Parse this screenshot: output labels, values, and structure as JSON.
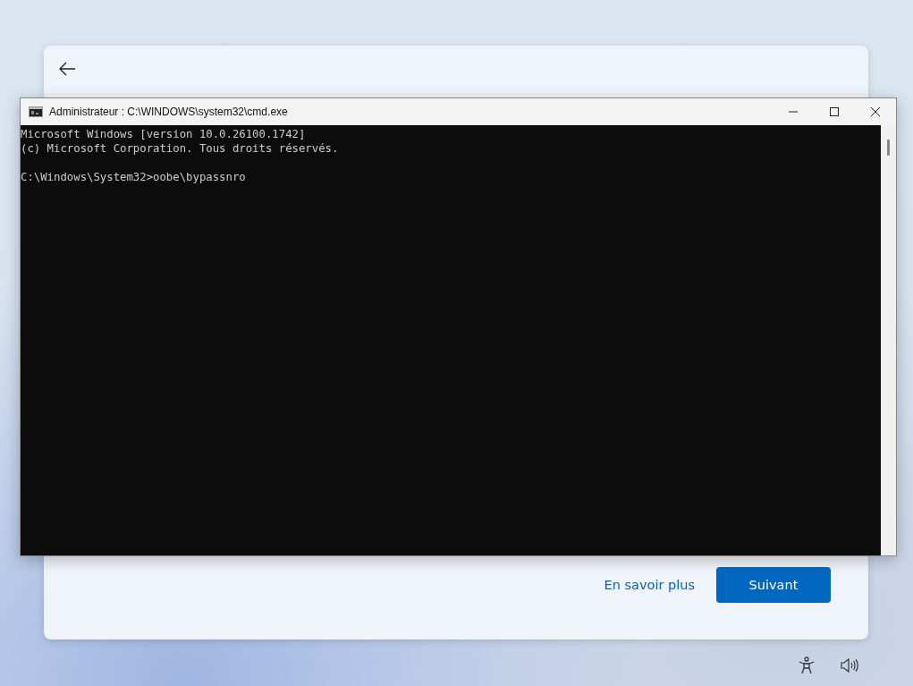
{
  "setup_page": {
    "link": "En savoir plus",
    "next_button": "Suivant"
  },
  "console_window": {
    "title": "Administrateur : C:\\WINDOWS\\system32\\cmd.exe",
    "banner": [
      "Microsoft Windows [version 10.0.26100.1742]",
      "(c) Microsoft Corporation. Tous droits réservés."
    ],
    "command_line": "C:\\Windows\\System32>oobe\\bypassnro"
  }
}
